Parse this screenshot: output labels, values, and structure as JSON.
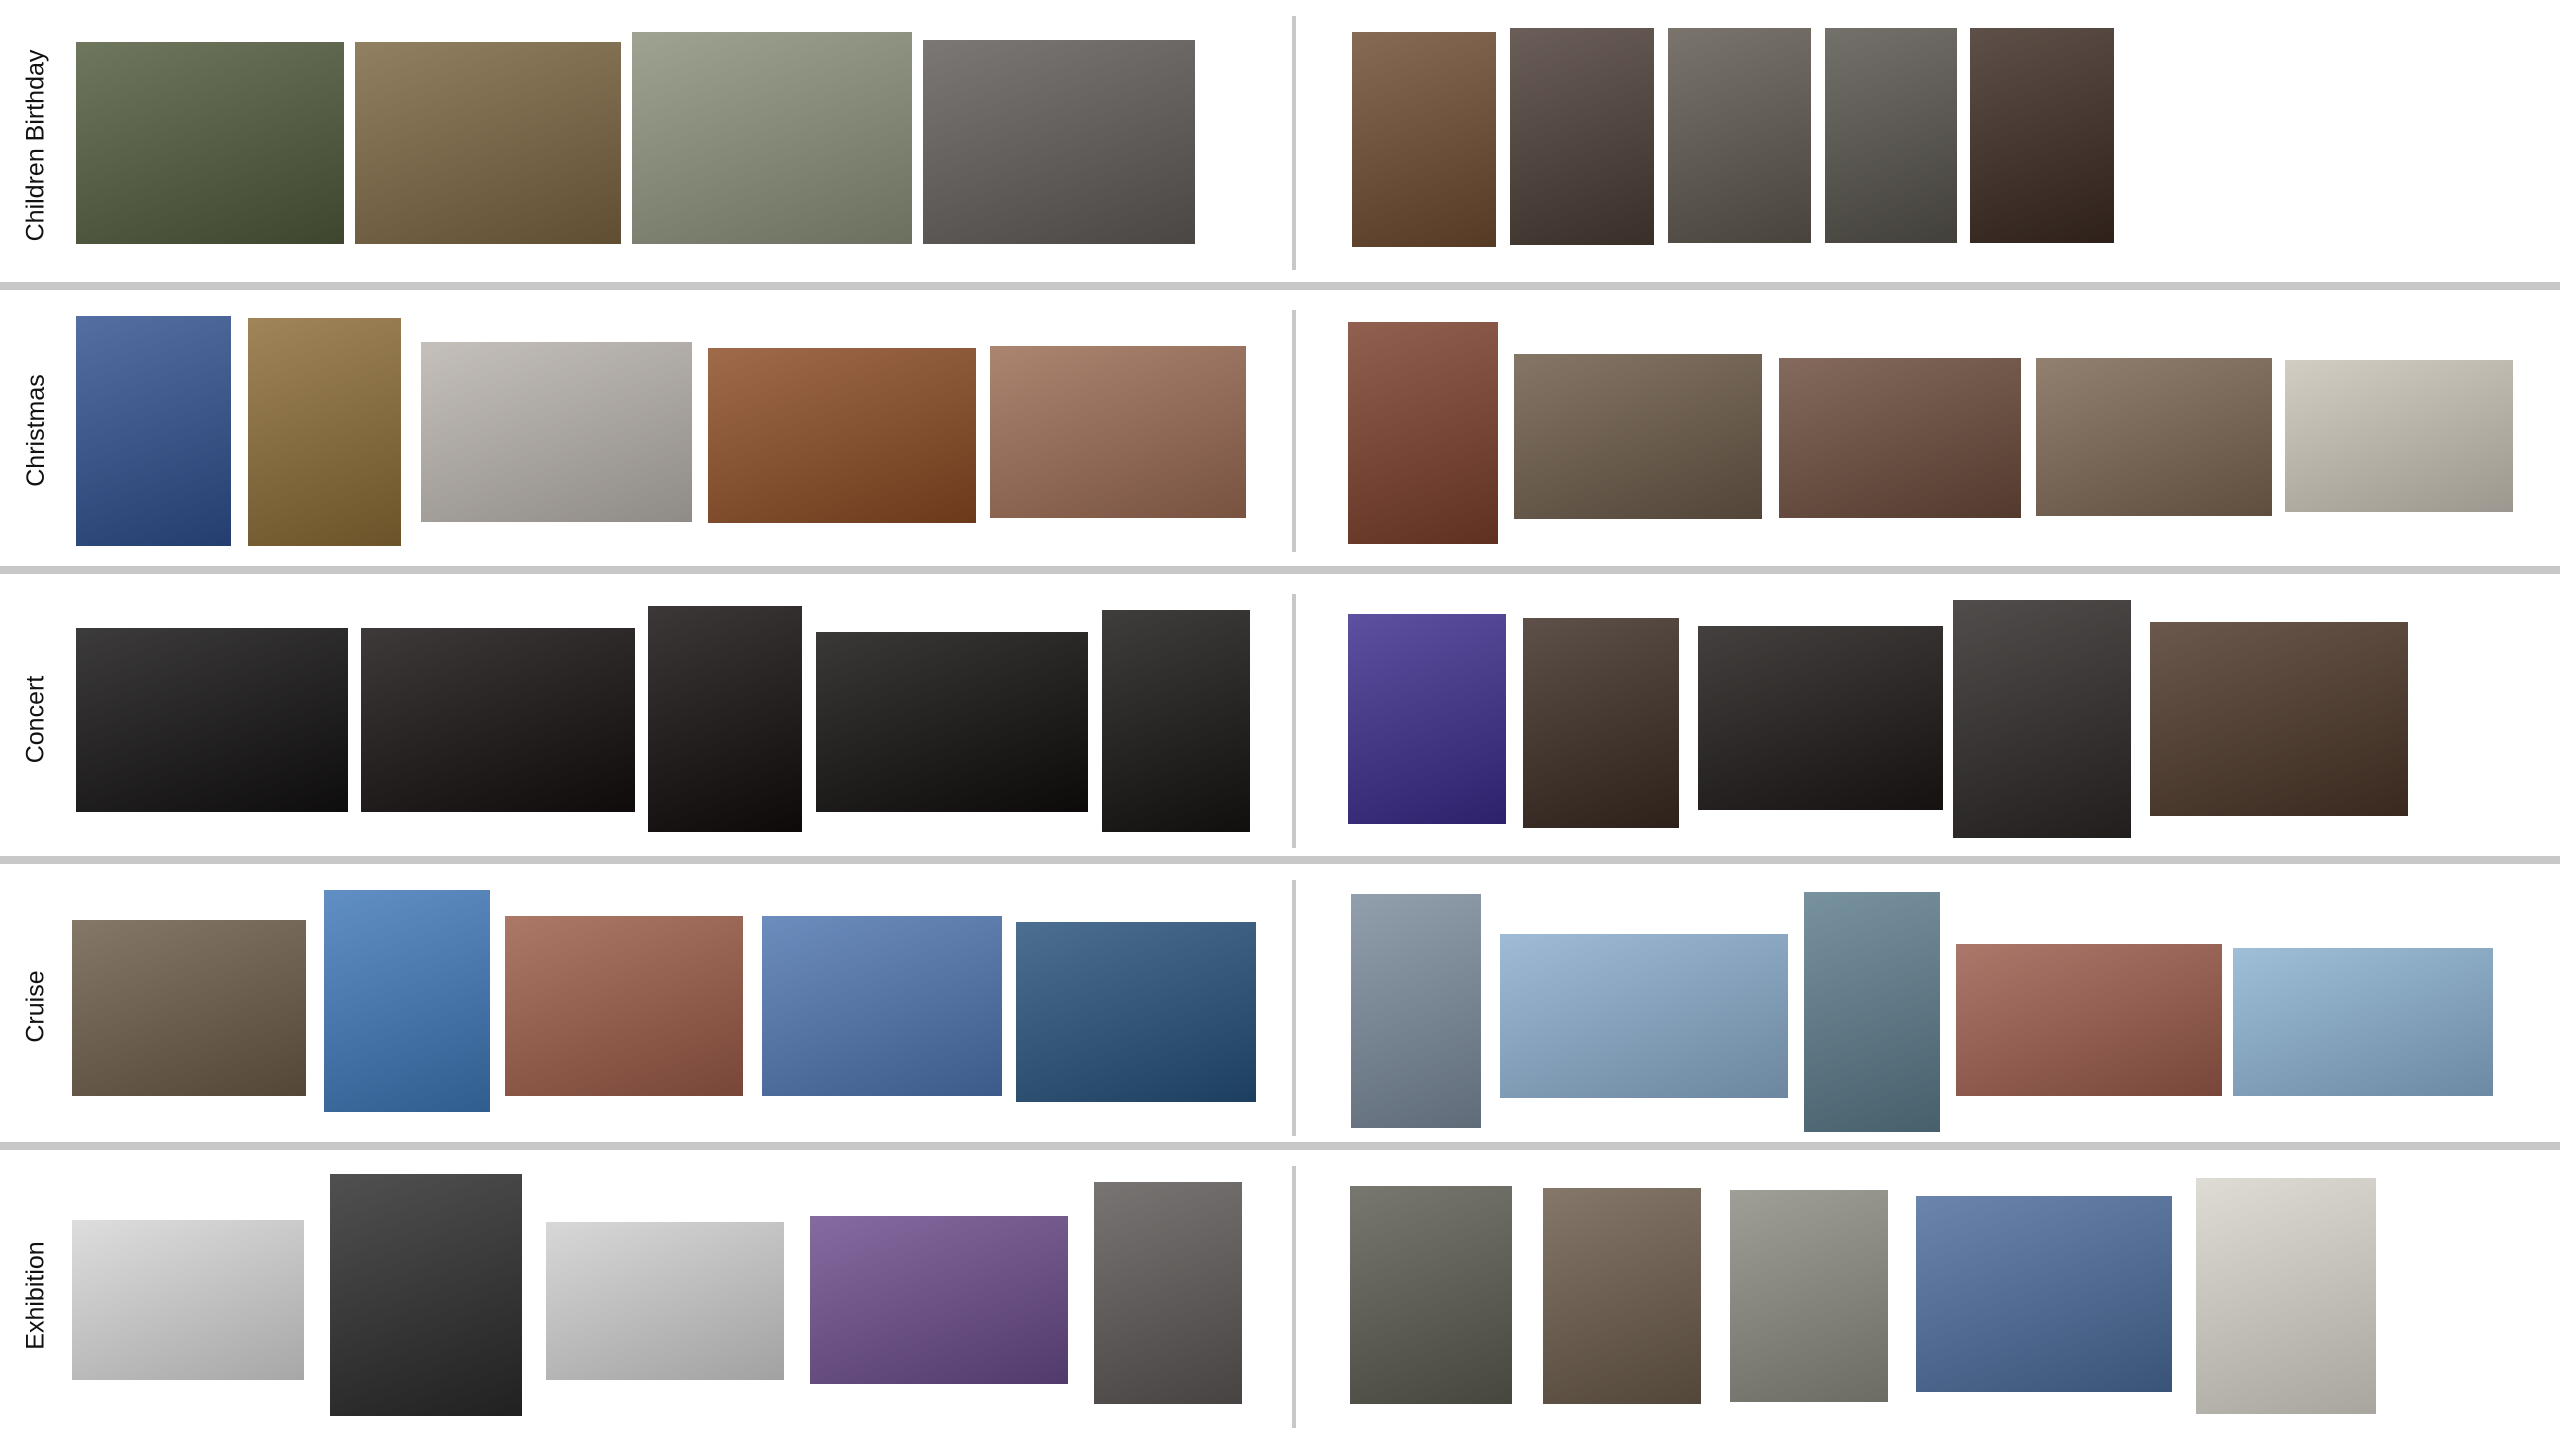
{
  "rows": [
    {
      "label": "Children Birthday",
      "photos": [
        {
          "name": "yard-kids-photo",
          "color": "#4f5a3a"
        },
        {
          "name": "playset-photo",
          "color": "#7a6440"
        },
        {
          "name": "party-table-photo",
          "color": "#8a8f7a"
        },
        {
          "name": "cupcakes-tray-photo",
          "color": "#5f5a57"
        },
        {
          "name": "baby-grandpa-photo",
          "color": "#6d4a2e"
        },
        {
          "name": "mother-kids-photo",
          "color": "#4a3b34"
        },
        {
          "name": "cupcake-plate-photo",
          "color": "#5d564c"
        },
        {
          "name": "woman-child-window-photo",
          "color": "#55524a"
        },
        {
          "name": "dad-baby-photo",
          "color": "#3b2a20"
        }
      ]
    },
    {
      "label": "Christmas",
      "photos": [
        {
          "name": "wrapped-gifts-photo",
          "color": "#2f4f8f"
        },
        {
          "name": "christmas-tree-photo",
          "color": "#8a6a34"
        },
        {
          "name": "man-coat-photo",
          "color": "#b8b2ac"
        },
        {
          "name": "roast-ham-photo",
          "color": "#8a4a22"
        },
        {
          "name": "carving-board-photo",
          "color": "#9a6a52"
        },
        {
          "name": "tree-kids-photo",
          "color": "#7a3d2a"
        },
        {
          "name": "grandparents-gift-photo",
          "color": "#6a5846"
        },
        {
          "name": "little-girls-photo",
          "color": "#6a4a3a"
        },
        {
          "name": "family-table-photo",
          "color": "#7a6450"
        },
        {
          "name": "cake-slice-photo",
          "color": "#c9c2b7"
        }
      ]
    },
    {
      "label": "Concert",
      "photos": [
        {
          "name": "duo-stage-photo-1",
          "color": "#121010"
        },
        {
          "name": "duo-stage-photo-2",
          "color": "#140e0e"
        },
        {
          "name": "duo-stage-photo-3",
          "color": "#120c0c"
        },
        {
          "name": "duo-stage-photo-4",
          "color": "#100c0c"
        },
        {
          "name": "singer-closeup-photo",
          "color": "#161212"
        },
        {
          "name": "guitarist-purple-photo",
          "color": "#3a2a8a"
        },
        {
          "name": "guitarist-pub-photo",
          "color": "#3a2a22"
        },
        {
          "name": "guitar-closeup-photo",
          "color": "#1a1614"
        },
        {
          "name": "guitarist-portrait-photo",
          "color": "#2a2624"
        },
        {
          "name": "guitarist-lights-photo",
          "color": "#4a3426"
        }
      ]
    },
    {
      "label": "Cruise",
      "photos": [
        {
          "name": "hotel-room-photo",
          "color": "#6a5a46"
        },
        {
          "name": "palm-tree-photo",
          "color": "#3e77b8"
        },
        {
          "name": "atrium-photo",
          "color": "#9a5a46"
        },
        {
          "name": "ship-deck-photo",
          "color": "#4d74b0"
        },
        {
          "name": "yacht-photo",
          "color": "#25507a"
        },
        {
          "name": "ship-funnel-photo",
          "color": "#7a8a9a"
        },
        {
          "name": "waterslide-sky-photo",
          "color": "#8aaccc"
        },
        {
          "name": "pool-deck-photo",
          "color": "#5a7a8a"
        },
        {
          "name": "red-funnel-photo",
          "color": "#9a5a4a"
        },
        {
          "name": "water-park-photo",
          "color": "#8ab0d0"
        }
      ]
    },
    {
      "label": "Exhibition",
      "photos": [
        {
          "name": "photo-prints-photo",
          "color": "#d6d6d6"
        },
        {
          "name": "botanical-print-photo",
          "color": "#2a2a2a"
        },
        {
          "name": "black-boxes-photo",
          "color": "#cfcfcf"
        },
        {
          "name": "typography-poster-photo",
          "color": "#6a4a8a"
        },
        {
          "name": "coffee-cart-photo",
          "color": "#5a5654"
        },
        {
          "name": "display-cases-photo",
          "color": "#5a5a50"
        },
        {
          "name": "puppet-photo-1",
          "color": "#6a5a4a"
        },
        {
          "name": "puppet-photo-2",
          "color": "#8a8a80"
        },
        {
          "name": "beach-booth-photo",
          "color": "#4a6a9a"
        },
        {
          "name": "placard-photo",
          "color": "#d8d4cc"
        }
      ]
    }
  ]
}
